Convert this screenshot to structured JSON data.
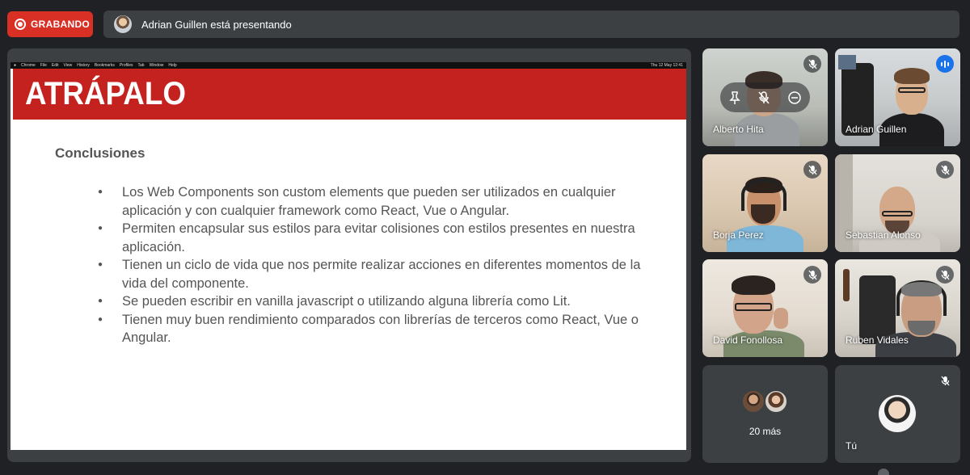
{
  "recording": {
    "label": "GRABANDO"
  },
  "presenting": {
    "text": "Adrian Guillen está presentando"
  },
  "slide": {
    "menubar": [
      "Chrome",
      "File",
      "Edit",
      "View",
      "History",
      "Bookmarks",
      "Profiles",
      "Tab",
      "Window",
      "Help"
    ],
    "clock": "Thu 12 May 12:41",
    "brand": "ATRÁPALO",
    "title": "Conclusiones",
    "bullets": [
      "Los Web Components son custom elements que pueden ser utilizados en cualquier aplicación y con cualquier framework como React, Vue o Angular.",
      "Permiten encapsular sus estilos para evitar colisiones con estilos presentes en nuestra aplicación.",
      "Tienen un ciclo de vida que nos permite realizar acciones en diferentes momentos de la vida del componente.",
      "Se pueden escribir en vanilla javascript o utilizando alguna librería como Lit.",
      "Tienen muy buen rendimiento comparados con librerías de terceros como React, Vue o Angular."
    ]
  },
  "participants": [
    {
      "name": "Alberto Hita",
      "state": "muted",
      "icon": "mic-off-icon"
    },
    {
      "name": "Adrian Guillen",
      "state": "speaking",
      "icon": "speaking-icon"
    },
    {
      "name": "Borja Perez",
      "state": "muted",
      "icon": "mic-off-icon"
    },
    {
      "name": "Sebastian Alonso",
      "state": "muted",
      "icon": "mic-off-icon"
    },
    {
      "name": "David Fonollosa",
      "state": "muted",
      "icon": "mic-off-icon"
    },
    {
      "name": "Ruben Vidales",
      "state": "muted",
      "icon": "mic-off-icon"
    }
  ],
  "more": {
    "label": "20 más"
  },
  "self": {
    "name": "Tú",
    "state": "muted"
  },
  "colors": {
    "background": "#202124",
    "tile": "#3c4043",
    "recording": "#d93025",
    "speaking": "#1a73e8",
    "brand_red": "#c4221f"
  }
}
